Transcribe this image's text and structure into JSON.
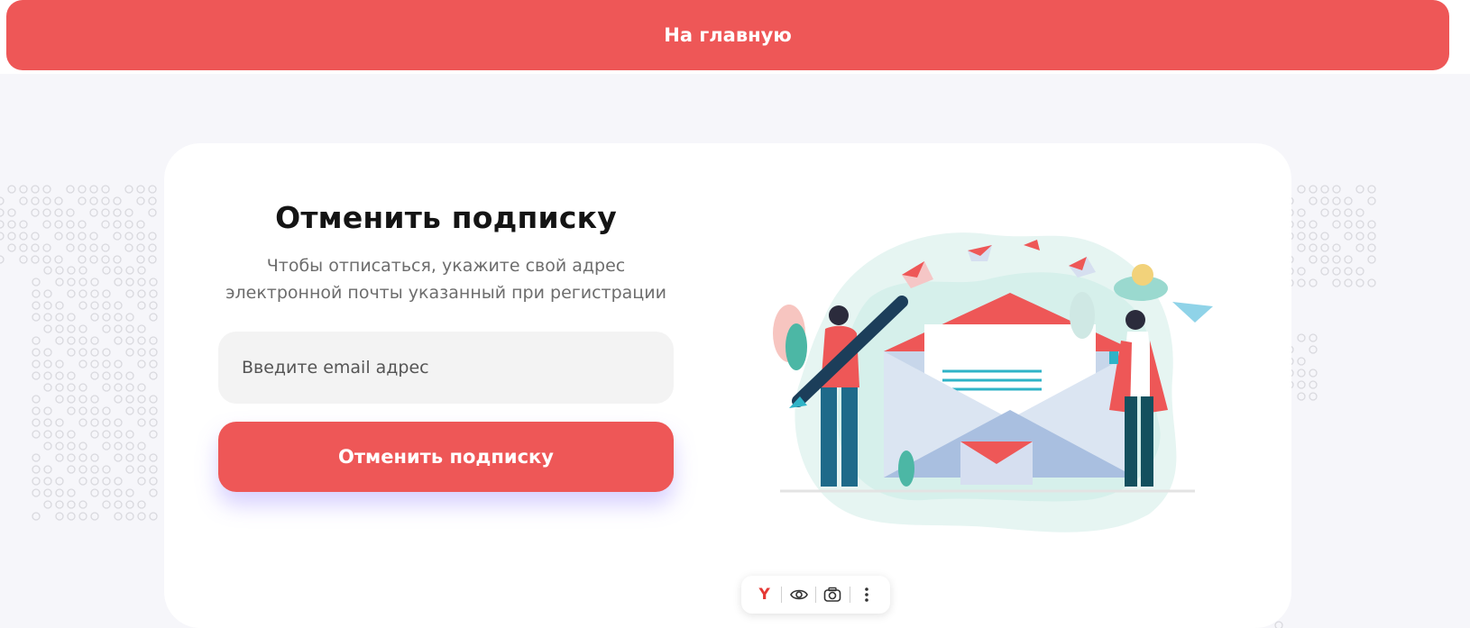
{
  "header": {
    "home_label": "На главную"
  },
  "unsubscribe": {
    "title": "Отменить подписку",
    "subtitle_line1": "Чтобы отписаться, укажите свой адрес",
    "subtitle_line2": "электронной почты указанный при регистрации",
    "email_placeholder": "Введите email адрес",
    "email_value": "",
    "submit_label": "Отменить подписку"
  },
  "toolbar": {
    "items": [
      {
        "icon": "yandex-icon",
        "glyph": "Y"
      },
      {
        "icon": "eye-icon"
      },
      {
        "icon": "camera-icon"
      },
      {
        "icon": "more-vertical-icon"
      }
    ]
  },
  "colors": {
    "accent": "#ee5757",
    "background": "#f6f6fa",
    "card": "#ffffff",
    "title": "#141414",
    "subtitle": "#6d6d6d"
  }
}
